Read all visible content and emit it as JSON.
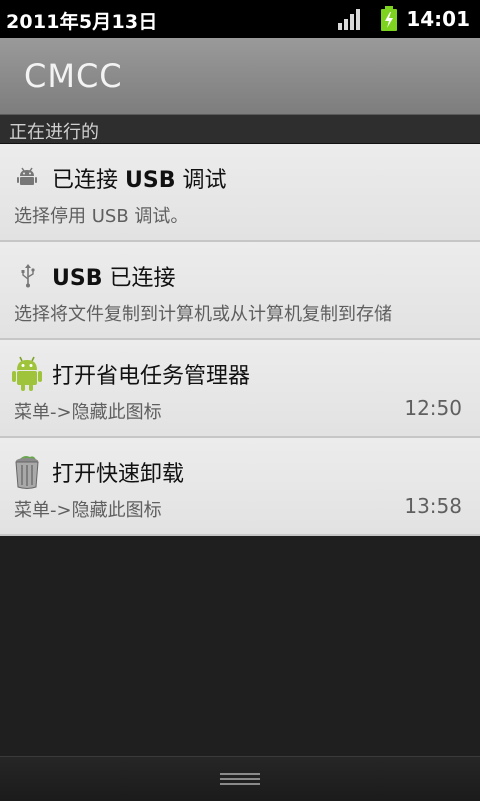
{
  "status_bar": {
    "date": "2011年5月13日",
    "time": "14:01",
    "icons": [
      "signal-icon",
      "battery-charging-icon"
    ]
  },
  "carrier": {
    "name": "CMCC"
  },
  "section": {
    "title": "正在进行的"
  },
  "notifications": [
    {
      "icon": "android-debug-icon",
      "title_prefix": "已连接",
      "title_bold": "USB",
      "title_suffix": "调试",
      "description": "选择停用 USB 调试。",
      "time": ""
    },
    {
      "icon": "usb-icon",
      "title_bold": "USB",
      "title_suffix": "已连接",
      "description": "选择将文件复制到计算机或从计算机复制到存储",
      "time": ""
    },
    {
      "icon": "android-task-manager-icon",
      "title": "打开省电任务管理器",
      "description": "菜单->隐藏此图标",
      "time": "12:50"
    },
    {
      "icon": "uninstall-trash-icon",
      "title": "打开快速卸载",
      "description": "菜单->隐藏此图标",
      "time": "13:58"
    }
  ],
  "colors": {
    "battery": "#7ed321",
    "android_green": "#9fc33b"
  }
}
